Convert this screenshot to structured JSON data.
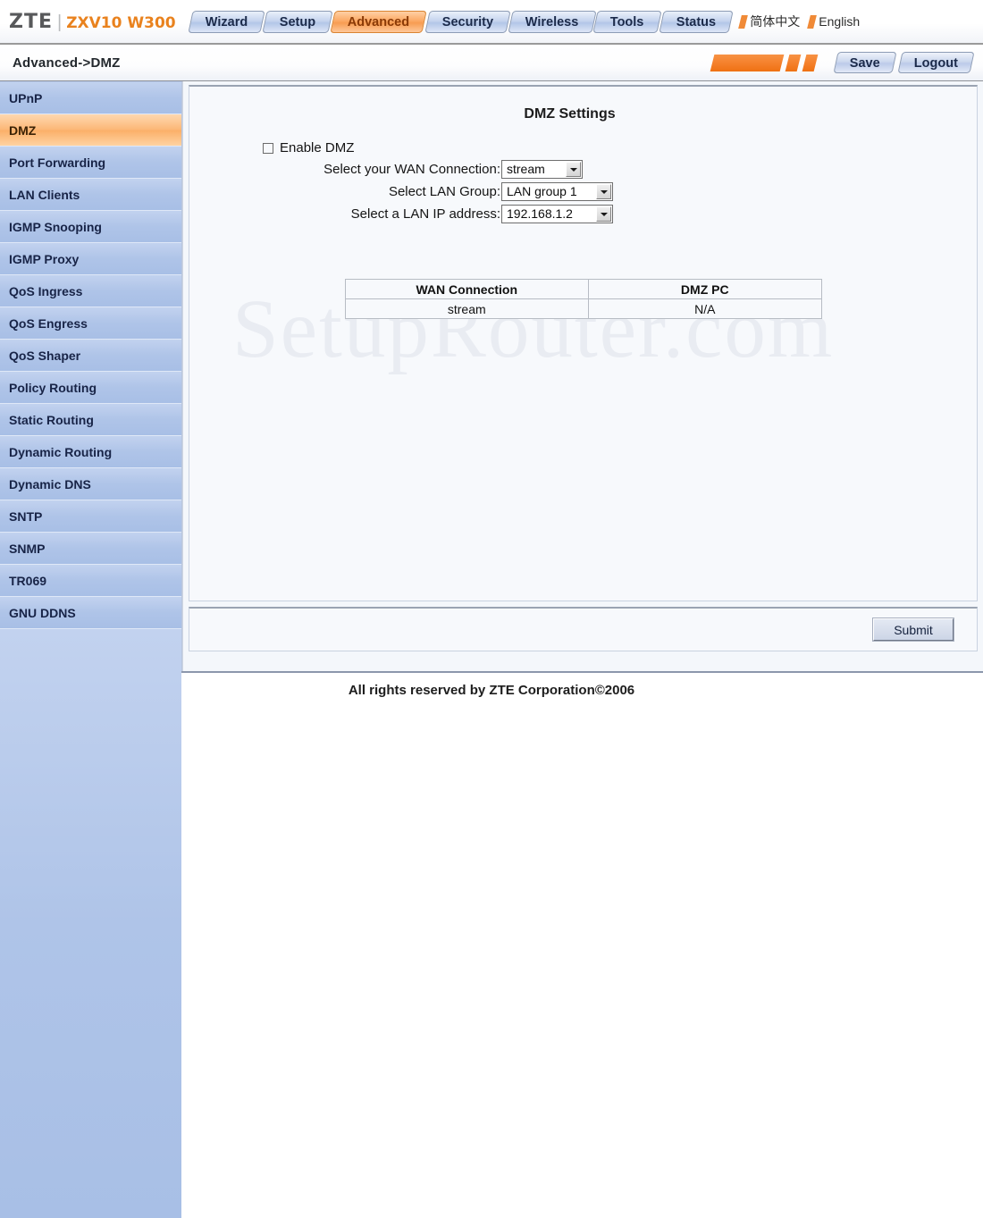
{
  "brand": {
    "name": "ZTE",
    "separator": "|",
    "model": "ZXV10 W300"
  },
  "nav": {
    "tabs": [
      {
        "label": "Wizard",
        "active": false
      },
      {
        "label": "Setup",
        "active": false
      },
      {
        "label": "Advanced",
        "active": true
      },
      {
        "label": "Security",
        "active": false
      },
      {
        "label": "Wireless",
        "active": false
      },
      {
        "label": "Tools",
        "active": false
      },
      {
        "label": "Status",
        "active": false
      }
    ],
    "languages": [
      {
        "label": "简体中文"
      },
      {
        "label": "English"
      }
    ]
  },
  "header": {
    "breadcrumb": "Advanced->DMZ",
    "save_label": "Save",
    "logout_label": "Logout"
  },
  "sidebar": {
    "items": [
      {
        "label": "UPnP",
        "active": false
      },
      {
        "label": "DMZ",
        "active": true
      },
      {
        "label": "Port Forwarding",
        "active": false
      },
      {
        "label": "LAN Clients",
        "active": false
      },
      {
        "label": "IGMP Snooping",
        "active": false
      },
      {
        "label": "IGMP Proxy",
        "active": false
      },
      {
        "label": "QoS Ingress",
        "active": false
      },
      {
        "label": "QoS Engress",
        "active": false
      },
      {
        "label": "QoS Shaper",
        "active": false
      },
      {
        "label": "Policy Routing",
        "active": false
      },
      {
        "label": "Static Routing",
        "active": false
      },
      {
        "label": "Dynamic Routing",
        "active": false
      },
      {
        "label": "Dynamic DNS",
        "active": false
      },
      {
        "label": "SNTP",
        "active": false
      },
      {
        "label": "SNMP",
        "active": false
      },
      {
        "label": "TR069",
        "active": false
      },
      {
        "label": "GNU DDNS",
        "active": false
      }
    ]
  },
  "main": {
    "title": "DMZ Settings",
    "watermark": "SetupRouter.com",
    "enable_dmz": {
      "label": "Enable DMZ",
      "checked": false
    },
    "fields": [
      {
        "label": "Select your WAN Connection:",
        "value": "stream"
      },
      {
        "label": "Select LAN Group:",
        "value": "LAN group 1"
      },
      {
        "label": "Select a LAN IP address:",
        "value": "192.168.1.2"
      }
    ],
    "table": {
      "headers": [
        "WAN Connection",
        "DMZ PC"
      ],
      "rows": [
        [
          "stream",
          "N/A"
        ]
      ]
    },
    "submit_label": "Submit"
  },
  "footer": {
    "text": "All rights reserved by ZTE Corporation©2006"
  },
  "colors": {
    "accent_orange": "#f5812c",
    "tab_blue": "#b3c6e8",
    "sidebar_blue": "#afc4e8",
    "text_dark": "#182447"
  }
}
